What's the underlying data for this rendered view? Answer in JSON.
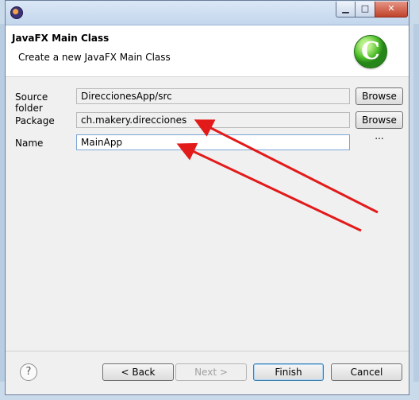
{
  "window": {
    "controls": {
      "minimize": "▁",
      "maximize": "□",
      "close": "✕"
    }
  },
  "header": {
    "title": "JavaFX Main Class",
    "description": "Create a new JavaFX Main Class",
    "logo_letter": "C"
  },
  "form": {
    "source_folder": {
      "label": "Source folder",
      "value": "DireccionesApp/src",
      "browse_label": "Browse ..."
    },
    "package": {
      "label": "Package",
      "value": "ch.makery.direcciones",
      "browse_label": "Browse ..."
    },
    "name": {
      "label": "Name",
      "value": "MainApp"
    }
  },
  "footer": {
    "help_label": "?",
    "back_label": "< Back",
    "next_label": "Next >",
    "finish_label": "Finish",
    "cancel_label": "Cancel"
  },
  "annotations": {
    "arrow_color": "#e31a1a"
  },
  "colors": {
    "window_bg": "#f0f0f0",
    "header_bg": "#ffffff",
    "desktop_bg": "#c9daeb"
  }
}
